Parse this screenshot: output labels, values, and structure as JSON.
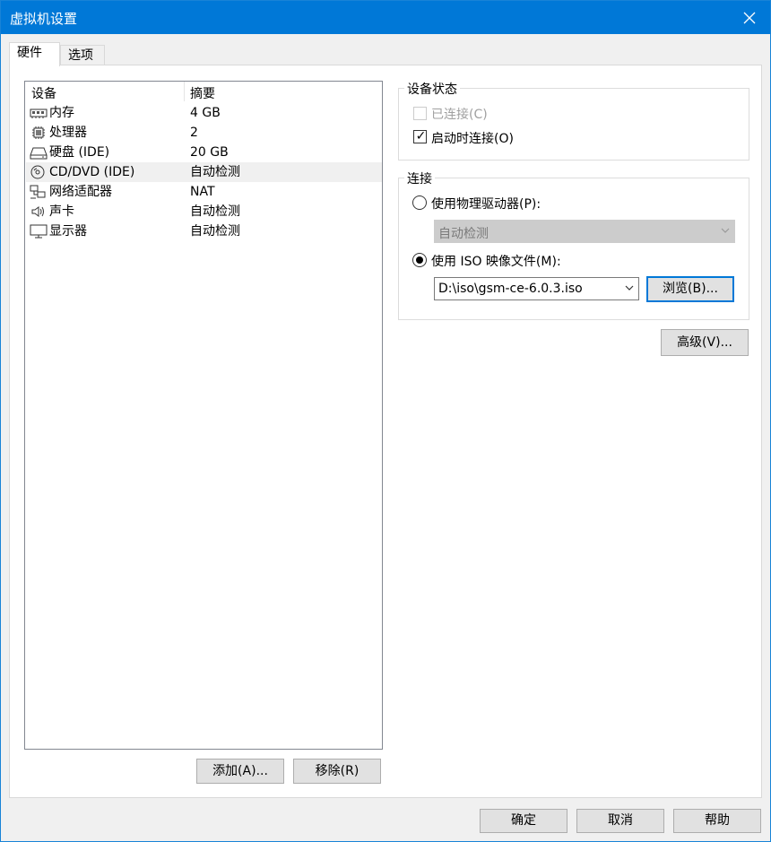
{
  "window": {
    "title": "虚拟机设置"
  },
  "tabs": [
    {
      "label": "硬件"
    },
    {
      "label": "选项"
    }
  ],
  "device_list": {
    "columns": [
      "设备",
      "摘要"
    ],
    "rows": [
      {
        "icon": "memory-icon",
        "name": "内存",
        "summary": "4 GB"
      },
      {
        "icon": "processor-icon",
        "name": "处理器",
        "summary": "2"
      },
      {
        "icon": "hard-disk-icon",
        "name": "硬盘 (IDE)",
        "summary": "20 GB"
      },
      {
        "icon": "cd-dvd-icon",
        "name": "CD/DVD (IDE)",
        "summary": "自动检测"
      },
      {
        "icon": "network-adapter-icon",
        "name": "网络适配器",
        "summary": "NAT"
      },
      {
        "icon": "sound-card-icon",
        "name": "声卡",
        "summary": "自动检测"
      },
      {
        "icon": "display-icon",
        "name": "显示器",
        "summary": "自动检测"
      }
    ],
    "selected_index": 3
  },
  "buttons": {
    "add": "添加(A)...",
    "remove": "移除(R)",
    "browse": "浏览(B)...",
    "advanced": "高级(V)...",
    "ok": "确定",
    "cancel": "取消",
    "help": "帮助"
  },
  "device_status": {
    "legend": "设备状态",
    "connected_label": "已连接(C)",
    "connected_checked": false,
    "connect_at_power_on_label": "启动时连接(O)",
    "connect_at_power_on_checked": true
  },
  "connection": {
    "legend": "连接",
    "physical_drive_label": "使用物理驱动器(P):",
    "physical_drive_value": "自动检测",
    "iso_label": "使用 ISO 映像文件(M):",
    "iso_path": "D:\\iso\\gsm-ce-6.0.3.iso",
    "selected": "iso"
  },
  "colors": {
    "titlebar": "#0078d7",
    "selected_row": "#f0f0f0",
    "focus_border": "#0078d7"
  }
}
